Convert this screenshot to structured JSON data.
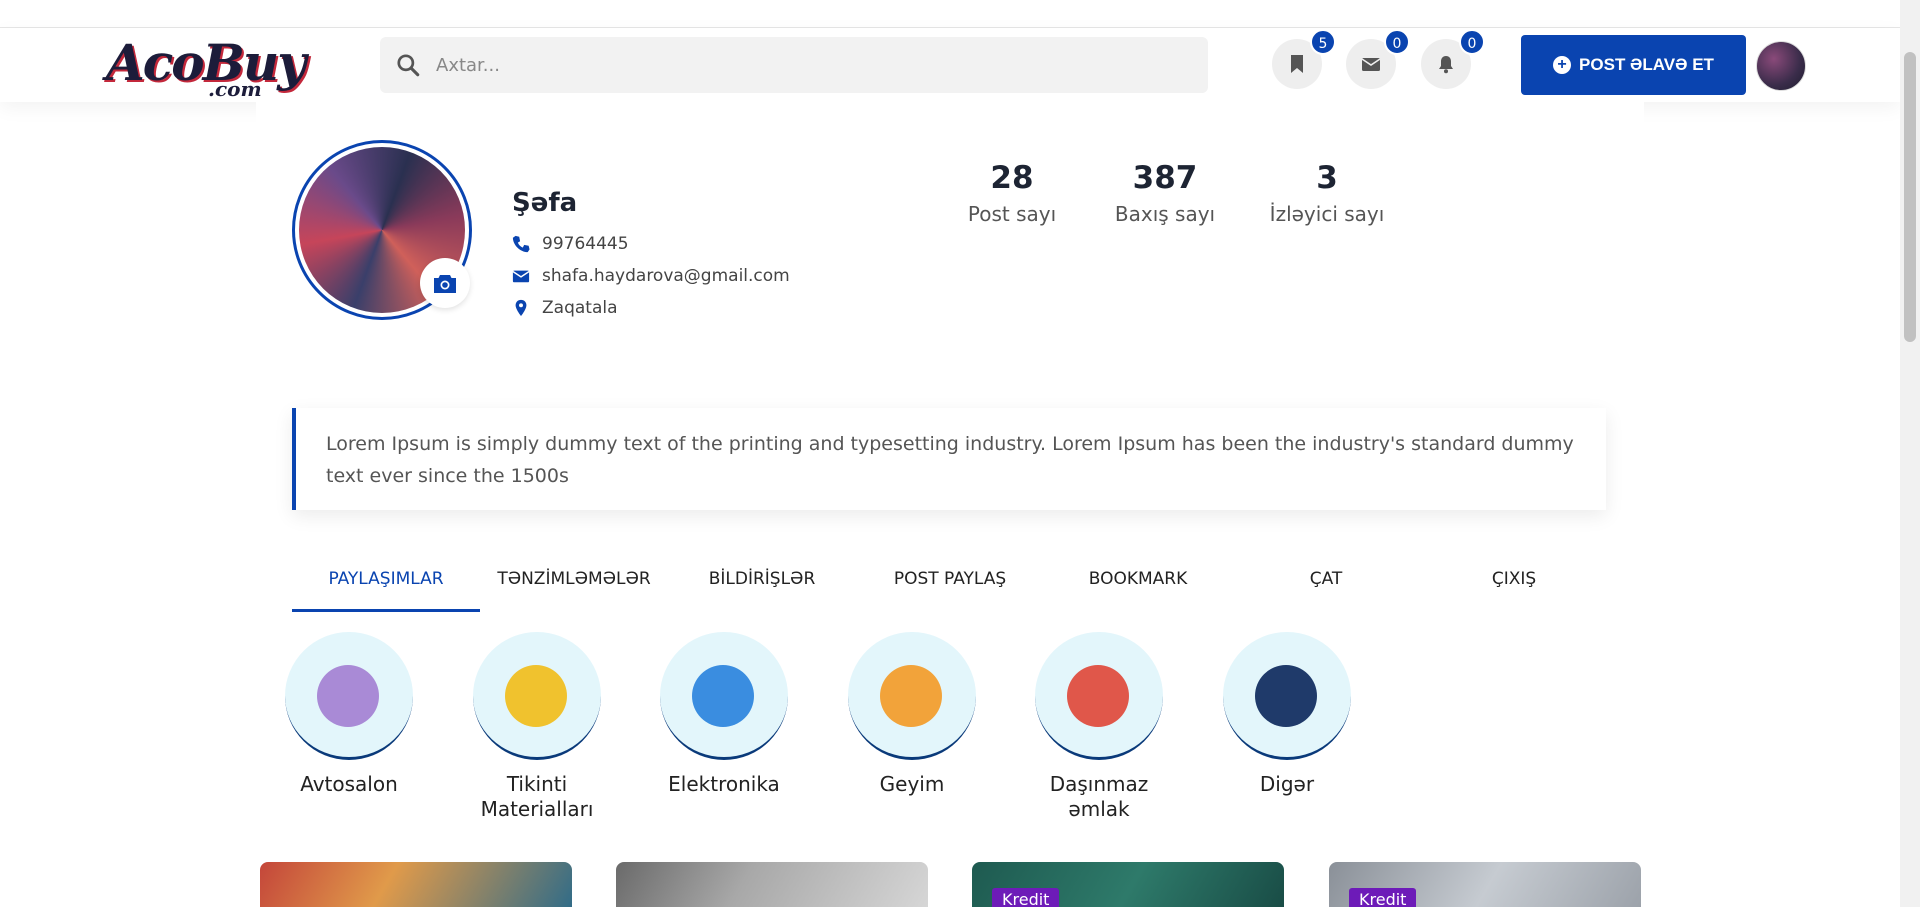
{
  "header": {
    "logo_text": "AcoBuy",
    "logo_suffix": ".com",
    "search_placeholder": "Axtar...",
    "bookmark_count": "5",
    "message_count": "0",
    "notification_count": "0",
    "post_button_label": "POST ƏLAVƏ ET"
  },
  "profile": {
    "name": "Şəfa",
    "phone": "99764445",
    "email": "shafa.haydarova@gmail.com",
    "location": "Zaqatala",
    "stats": [
      {
        "value": "28",
        "label": "Post sayı"
      },
      {
        "value": "387",
        "label": "Baxış sayı"
      },
      {
        "value": "3",
        "label": "İzləyici sayı"
      }
    ],
    "bio": "Lorem Ipsum is simply dummy text of the printing and typesetting industry. Lorem Ipsum has been the industry's standard dummy text ever since the 1500s"
  },
  "tabs": [
    {
      "label": "PAYLAŞIMLAR",
      "active": true
    },
    {
      "label": "TƏNZİMLƏMƏLƏR"
    },
    {
      "label": "BİLDİRİŞLƏR"
    },
    {
      "label": "POST PAYLAŞ"
    },
    {
      "label": "BOOKMARK"
    },
    {
      "label": "ÇAT"
    },
    {
      "label": "ÇIXIŞ"
    }
  ],
  "categories": [
    {
      "label": "Avtosalon",
      "icon": "car-icon",
      "color": "#a98ad6"
    },
    {
      "label": "Tikinti Materialları",
      "icon": "hammer-icon",
      "color": "#f0c22e"
    },
    {
      "label": "Elektronika",
      "icon": "phone-icon",
      "color": "#3a8de0"
    },
    {
      "label": "Geyim",
      "icon": "clothing-icon",
      "color": "#f2a33a"
    },
    {
      "label": "Daşınmaz əmlak",
      "icon": "building-icon",
      "color": "#e0574a"
    },
    {
      "label": "Digər",
      "icon": "books-icon",
      "color": "#1f3a6a"
    }
  ],
  "listings": [
    {
      "badge": ""
    },
    {
      "badge": ""
    },
    {
      "badge": "Kredit"
    },
    {
      "badge": "Kredit"
    }
  ],
  "colors": {
    "accent": "#0a44b0",
    "badge_purple": "#6d1bb8",
    "category_bg": "#e3f6fb"
  }
}
